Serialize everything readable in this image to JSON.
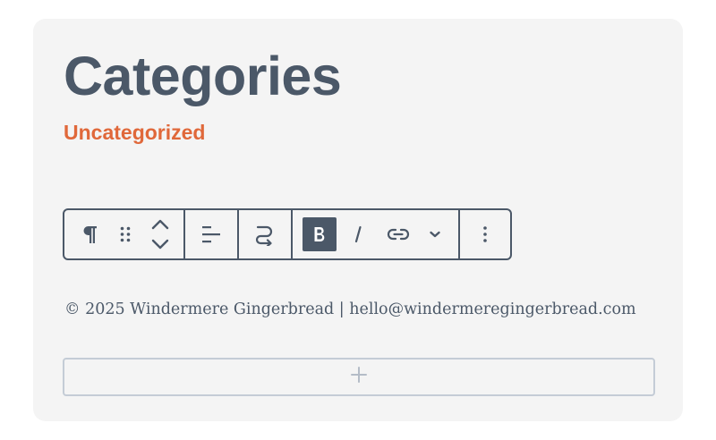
{
  "heading": {
    "title": "Categories"
  },
  "categories": {
    "items": [
      "Uncategorized"
    ],
    "link_color": "#e0683a"
  },
  "toolbar": {
    "buttons": [
      {
        "icon": "paragraph-icon",
        "label": "Paragraph"
      },
      {
        "icon": "drag-handle-icon",
        "label": "Drag"
      },
      {
        "icon": "move-up-down-icon",
        "label": "Move up / Move down"
      },
      {
        "icon": "align-text-icon",
        "label": "Align text"
      },
      {
        "icon": "transform-icon",
        "label": "Transform"
      },
      {
        "icon": "bold-icon",
        "label": "Bold",
        "active": true
      },
      {
        "icon": "italic-icon",
        "label": "Italic"
      },
      {
        "icon": "link-icon",
        "label": "Link"
      },
      {
        "icon": "chevron-down-icon",
        "label": "More rich text controls"
      },
      {
        "icon": "more-vertical-icon",
        "label": "Options"
      }
    ]
  },
  "footer": {
    "text": "© 2025 Windermere Gingerbread | hello@windermeregingerbread.com"
  },
  "appender": {
    "icon": "plus-icon",
    "label": "Add block"
  },
  "colors": {
    "text": "#4b5868",
    "accent": "#e0683a",
    "card_bg": "#f4f4f4",
    "appender_border": "#c4ccd6"
  }
}
